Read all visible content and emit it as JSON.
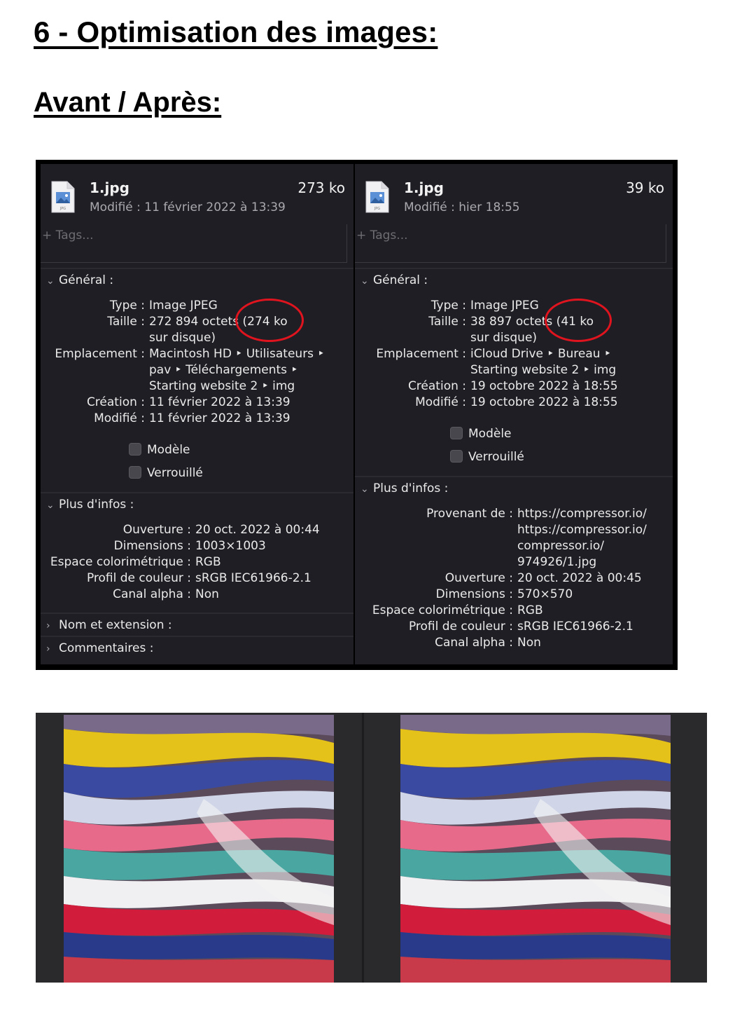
{
  "heading": "6 - Optimisation des images:",
  "subheading": "Avant / Après:",
  "colors": {
    "panel_bg": "#1f1e24",
    "circle": "#e0141e"
  },
  "panels": [
    {
      "file_name": "1.jpg",
      "file_size": "273 ko",
      "modified_line": "Modifié : 11 février 2022 à 13:39",
      "tags_placeholder": "+ Tags...",
      "general_title": "Général :",
      "general_rows": [
        {
          "k": "Type :",
          "v": "Image JPEG"
        },
        {
          "k": "Taille :",
          "v": "272 894 octets (274 ko"
        },
        {
          "k": "",
          "v": "sur disque)"
        },
        {
          "k": "Emplacement :",
          "v": "Macintosh HD ‣ Utilisateurs ‣"
        },
        {
          "k": "",
          "v": "pav ‣ Téléchargements ‣"
        },
        {
          "k": "",
          "v": "Starting website 2 ‣ img"
        },
        {
          "k": "Création :",
          "v": "11 février 2022 à 13:39"
        },
        {
          "k": "Modifié :",
          "v": "11 février 2022 à 13:39"
        }
      ],
      "checkboxes": [
        "Modèle",
        "Verrouillé"
      ],
      "more_title": "Plus d'infos :",
      "more_rows": [
        {
          "k": "Ouverture :",
          "v": "20 oct. 2022 à 00:44"
        },
        {
          "k": "Dimensions :",
          "v": "1003×1003"
        },
        {
          "k": "Espace colorimétrique :",
          "v": "RGB"
        },
        {
          "k": "Profil de couleur :",
          "v": "sRGB IEC61966-2.1"
        },
        {
          "k": "Canal alpha :",
          "v": "Non"
        }
      ],
      "extra_sections": [
        "Nom et extension :",
        "Commentaires :"
      ]
    },
    {
      "file_name": "1.jpg",
      "file_size": "39 ko",
      "modified_line": "Modifié : hier 18:55",
      "tags_placeholder": "+ Tags...",
      "general_title": "Général :",
      "general_rows": [
        {
          "k": "Type :",
          "v": "Image JPEG"
        },
        {
          "k": "Taille :",
          "v": "38 897 octets (41 ko"
        },
        {
          "k": "",
          "v": "sur disque)"
        },
        {
          "k": "Emplacement :",
          "v": "iCloud Drive ‣ Bureau ‣"
        },
        {
          "k": "",
          "v": "Starting website 2 ‣ img"
        },
        {
          "k": "Création :",
          "v": "19 octobre 2022 à 18:55"
        },
        {
          "k": "Modifié :",
          "v": "19 octobre 2022 à 18:55"
        }
      ],
      "checkboxes": [
        "Modèle",
        "Verrouillé"
      ],
      "more_title": "Plus d'infos :",
      "more_rows": [
        {
          "k": "Provenant de :",
          "v": "https://compressor.io/"
        },
        {
          "k": "",
          "v": "https://compressor.io/"
        },
        {
          "k": "",
          "v": "compressor.io/"
        },
        {
          "k": "",
          "v": "974926/1.jpg"
        },
        {
          "k": "Ouverture :",
          "v": "20 oct. 2022 à 00:45"
        },
        {
          "k": "Dimensions :",
          "v": "570×570"
        },
        {
          "k": "Espace colorimétrique :",
          "v": "RGB"
        },
        {
          "k": "Profil de couleur :",
          "v": "sRGB IEC61966-2.1"
        },
        {
          "k": "Canal alpha :",
          "v": "Non"
        }
      ]
    }
  ]
}
